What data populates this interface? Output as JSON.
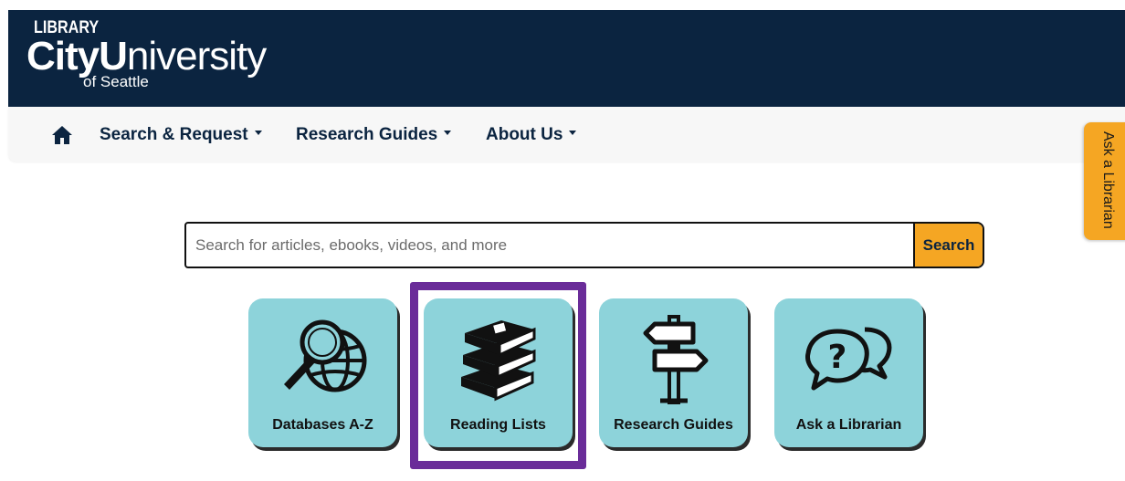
{
  "header": {
    "logo_library": "LIBRARY",
    "logo_city": "City",
    "logo_u": "U",
    "logo_niversity": "niversity",
    "logo_sub": "of Seattle"
  },
  "nav": {
    "home_icon": "home-icon",
    "items": [
      {
        "label": "Search & Request"
      },
      {
        "label": "Research Guides"
      },
      {
        "label": "About Us"
      }
    ]
  },
  "side_tab": {
    "label": "Ask a Librarian"
  },
  "search": {
    "placeholder": "Search for articles, ebooks, videos, and more",
    "value": "",
    "button_label": "Search"
  },
  "tiles": [
    {
      "label": "Databases A-Z",
      "icon": "magnifier-globe-icon"
    },
    {
      "label": "Reading Lists",
      "icon": "book-stack-icon",
      "highlighted": true
    },
    {
      "label": "Research Guides",
      "icon": "signpost-icon"
    },
    {
      "label": "Ask a Librarian",
      "icon": "question-speech-bubbles-icon"
    }
  ],
  "colors": {
    "header_bg": "#0b2440",
    "nav_bg": "#f7f7f7",
    "accent_orange": "#f5a623",
    "tile_bg": "#8dd3da",
    "highlight_purple": "#6a2c99"
  }
}
